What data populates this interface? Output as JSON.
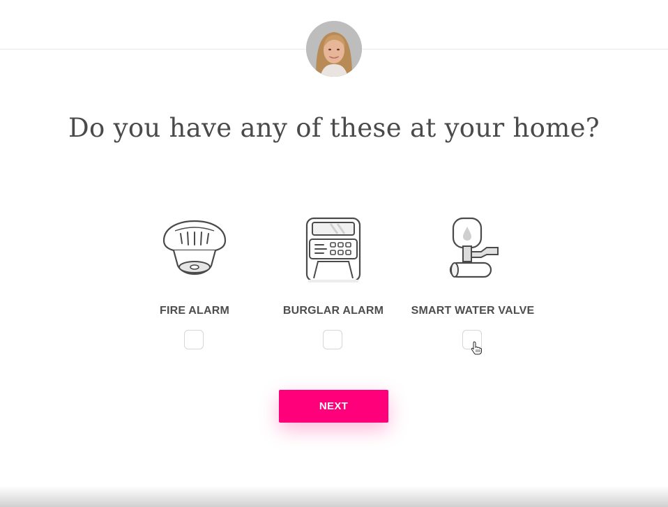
{
  "header": {
    "avatar_icon": "person-avatar"
  },
  "question": {
    "title": "Do you have any of these at your home?"
  },
  "options": [
    {
      "label": "FIRE ALARM",
      "icon": "fire-alarm-icon",
      "checked": false
    },
    {
      "label": "BURGLAR ALARM",
      "icon": "burglar-alarm-icon",
      "checked": false
    },
    {
      "label": "SMART WATER VALVE",
      "icon": "smart-water-valve-icon",
      "checked": false
    }
  ],
  "actions": {
    "next_label": "NEXT"
  },
  "colors": {
    "accent": "#ff007a",
    "text": "#4a4a4a",
    "border": "#d6d6d6"
  }
}
